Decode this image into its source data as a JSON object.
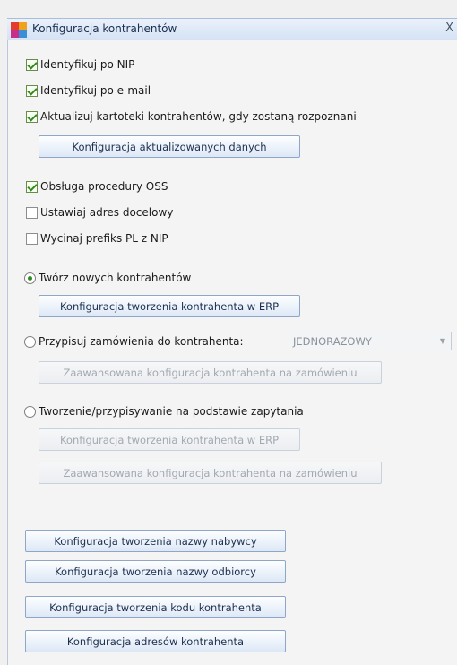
{
  "window": {
    "title": "Konfiguracja kontrahentów",
    "close_glyph": "X"
  },
  "options": {
    "identify_nip": {
      "label": "Identyfikuj po NIP",
      "checked": true
    },
    "identify_email": {
      "label": "Identyfikuj po e-mail",
      "checked": true
    },
    "update_records": {
      "label": "Aktualizuj kartoteki kontrahentów, gdy zostaną rozpoznani",
      "checked": true
    },
    "config_updated_data_button": "Konfiguracja aktualizowanych danych",
    "oss_procedure": {
      "label": "Obsługa procedury OSS",
      "checked": true
    },
    "set_destination_address": {
      "label": "Ustawiaj adres docelowy",
      "checked": false
    },
    "cut_pl_prefix": {
      "label": "Wycinaj prefiks PL z NIP",
      "checked": false
    }
  },
  "mode": {
    "create_new": {
      "label": "Twórz nowych kontrahentów",
      "selected": true
    },
    "create_new_config_button": "Konfiguracja tworzenia kontrahenta w ERP",
    "assign_orders": {
      "label": "Przypisuj zamówienia do kontrahenta:",
      "selected": false
    },
    "assign_orders_select": {
      "value": "JEDNORAZOWY"
    },
    "assign_orders_advanced_button": "Zaawansowana konfiguracja kontrahenta na zamówieniu",
    "by_query": {
      "label": "Tworzenie/przypisywanie na podstawie zapytania",
      "selected": false
    },
    "by_query_config_button": "Konfiguracja tworzenia kontrahenta w ERP",
    "by_query_advanced_button": "Zaawansowana konfiguracja kontrahenta na zamówieniu"
  },
  "bottom_buttons": {
    "buyer_name": "Konfiguracja tworzenia nazwy nabywcy",
    "recipient_name": "Konfiguracja tworzenia nazwy odbiorcy",
    "contractor_code": "Konfiguracja tworzenia kodu kontrahenta",
    "contractor_addresses": "Konfiguracja adresów kontrahenta"
  },
  "colors": {
    "accent": "#2e8b22",
    "title_bar": "#d4e2f4",
    "button_border": "#8ea7c8",
    "disabled_text": "#a3a9b1"
  }
}
